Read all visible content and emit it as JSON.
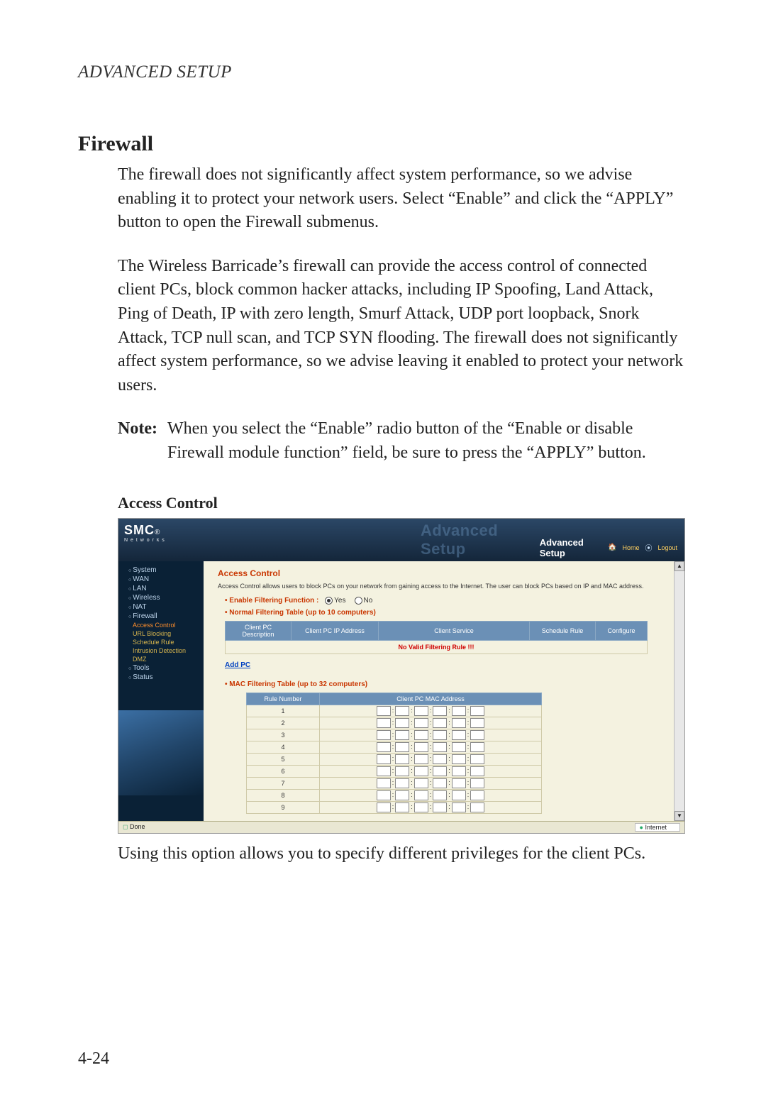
{
  "running_head": "ADVANCED SETUP",
  "section_title": "Firewall",
  "para1": "The firewall does not significantly affect system performance, so we advise enabling it to protect your network users. Select “Enable” and click the “APPLY” button to open the Firewall submenus.",
  "para2": "The Wireless Barricade’s firewall can provide the access control of connected client PCs, block common hacker attacks, including IP Spoofing, Land Attack, Ping of Death, IP with zero length, Smurf Attack, UDP port loopback, Snork Attack, TCP null scan, and TCP SYN flooding. The firewall does not significantly affect system performance, so we advise leaving it enabled to protect your network users.",
  "note_label": "Note:",
  "note_text": "When you select the “Enable” radio button of the “Enable or disable Firewall module function” field, be sure to press the “APPLY” button.",
  "subsection_title": "Access Control",
  "footer_para": "Using this option allows you to specify different privileges for the client PCs.",
  "page_number": "4-24",
  "screenshot": {
    "logo": "SMC",
    "logo_reg": "®",
    "logo_sub": "N e t w o r k s",
    "banner_back": "Advanced Setup",
    "banner_title": "Advanced Setup",
    "home_link": "Home",
    "logout_link": "Logout",
    "nav": {
      "system": "System",
      "wan": "WAN",
      "lan": "LAN",
      "wireless": "Wireless",
      "nat": "NAT",
      "firewall": "Firewall",
      "access_control": "Access Control",
      "url_blocking": "URL Blocking",
      "schedule_rule": "Schedule Rule",
      "intrusion": "Intrusion Detection",
      "dmz": "DMZ",
      "tools": "Tools",
      "status": "Status"
    },
    "content": {
      "title": "Access Control",
      "desc": "Access Control allows users to block PCs on your network from gaining access to the Internet. The user can block PCs based on IP and MAC address.",
      "enable_label": "Enable Filtering Function :",
      "yes": "Yes",
      "no": "No",
      "normal_table_label": "Normal Filtering Table (up to 10 computers)",
      "nf_headers": {
        "desc": "Client PC Description",
        "ip": "Client PC IP Address",
        "service": "Client Service",
        "schedule": "Schedule Rule",
        "configure": "Configure"
      },
      "no_valid": "No Valid Filtering Rule !!!",
      "add_pc": "Add PC",
      "mac_table_label": "MAC Filtering Table (up to 32 computers)",
      "mac_headers": {
        "rule": "Rule Number",
        "mac": "Client PC MAC Address"
      },
      "mac_rows": [
        "1",
        "2",
        "3",
        "4",
        "5",
        "6",
        "7",
        "8",
        "9"
      ]
    },
    "status_done": "Done",
    "status_net": "Internet"
  }
}
